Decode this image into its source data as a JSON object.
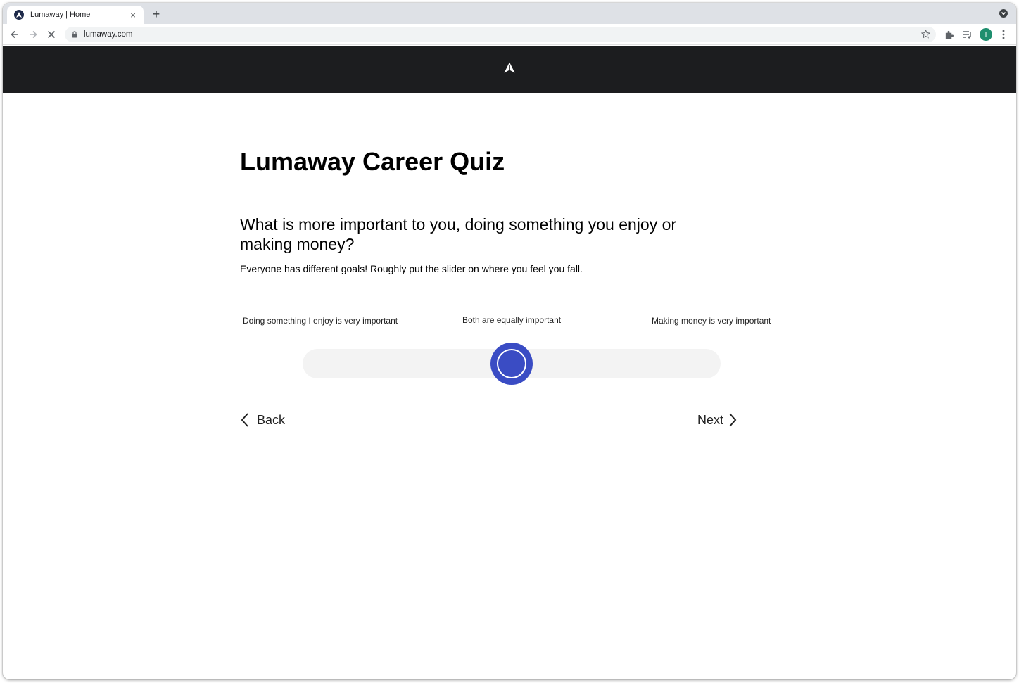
{
  "browser": {
    "tab_title": "Lumaway | Home",
    "tab_close": "×",
    "new_tab": "+",
    "url": "lumaway.com",
    "profile_initial": "I"
  },
  "site": {
    "logo": "lumaway-logo-icon"
  },
  "quiz": {
    "title": "Lumaway Career Quiz",
    "question": "What is more important to you, doing something you enjoy or making money?",
    "subtext": "Everyone has different goals! Roughly put the slider on where you feel you fall.",
    "scale": {
      "left_label": "Doing something I enjoy is very important",
      "middle_label": "Both are equally important",
      "right_label": "Making money is very important",
      "value_percent": 50
    },
    "back_label": "Back",
    "next_label": "Next"
  },
  "colors": {
    "accent": "#3a4cc4",
    "header_bg": "#1c1d1f",
    "track_bg": "#f3f3f3"
  }
}
